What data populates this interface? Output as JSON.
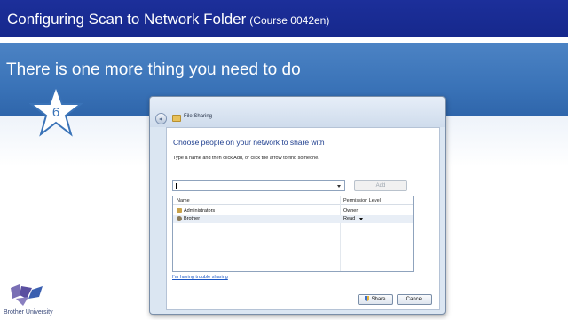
{
  "slide": {
    "title": "Configuring Scan to Network Folder",
    "course": "(Course 0042en)",
    "heading": "There is one more thing you need to do",
    "step_number": "6",
    "logo_text": "Brother University"
  },
  "dialog": {
    "window_title": "File Sharing",
    "choose_heading": "Choose people on your network to share with",
    "instructions": "Type a name and then click Add, or click the arrow to find someone.",
    "name_input_value": "",
    "add_label": "Add",
    "columns": [
      "Name",
      "Permission Level"
    ],
    "rows": [
      {
        "name": "Administrators",
        "permission": "Owner",
        "icon": "group-icon",
        "has_dropdown": false
      },
      {
        "name": "Brother",
        "permission": "Read",
        "icon": "user-icon",
        "has_dropdown": true
      }
    ],
    "trouble_link": "I'm having trouble sharing",
    "share_label": "Share",
    "cancel_label": "Cancel"
  },
  "colors": {
    "title_bar": "#1c2f9a",
    "banner": "#3a73b8",
    "link": "#1a56c4"
  }
}
